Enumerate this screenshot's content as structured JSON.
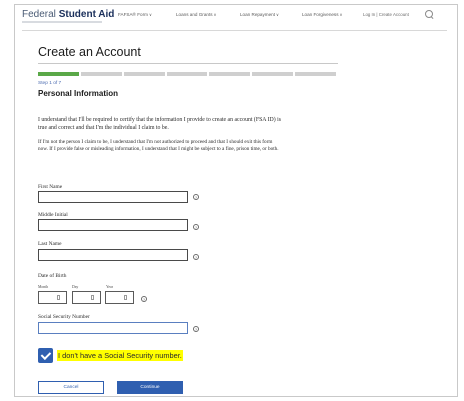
{
  "header": {
    "logo_light": "Federal ",
    "logo_bold": "Student Aid",
    "nav": [
      {
        "label": "FAFSA® Form",
        "chev": "∨"
      },
      {
        "label": "Loans and Grants",
        "chev": "∨"
      },
      {
        "label": "Loan Repayment",
        "chev": "∨"
      },
      {
        "label": "Loan Forgiveness",
        "chev": "∨"
      }
    ],
    "login": "Log In | Create Account",
    "search_icon": "search-icon"
  },
  "page": {
    "title": "Create an Account",
    "step": "Step 1 of 7",
    "steps_total": 7,
    "steps_completed": 1,
    "section_title": "Personal Information",
    "paragraph1": "I understand that I'll be required to certify that the information I provide to create an account (FSA ID) is true and correct and that I'm the individual I claim to be.",
    "paragraph2": "If I'm not the person I claim to be, I understand that I'm not authorized to proceed and that I should exit this form now. If I provide false or misleading information, I understand that I might be subject to a fine, prison time, or both."
  },
  "form": {
    "first_name_label": "First Name",
    "middle_initial_label": "Middle Initial",
    "last_name_label": "Last Name",
    "dob_label": "Date of Birth",
    "dob_month": "Month",
    "dob_day": "Day",
    "dob_year": "Year",
    "ssn_label": "Social Security Number",
    "help_glyph": "?",
    "no_ssn_label": "I don't have a Social Security number.",
    "no_ssn_checked": true,
    "cancel_label": "Cancel",
    "continue_label": "Continue"
  },
  "colors": {
    "brand_blue": "#2f5fb0",
    "progress_green": "#5aa848",
    "highlight": "#ffff00"
  }
}
